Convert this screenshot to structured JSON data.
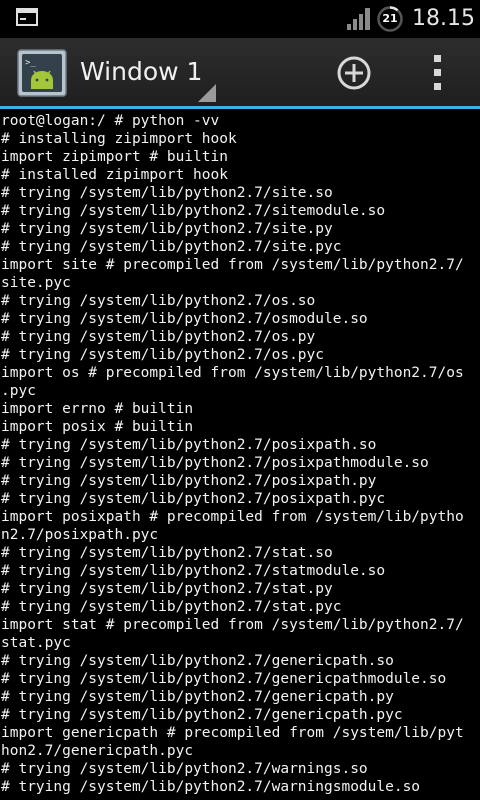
{
  "status_bar": {
    "icons": [
      "terminal-notification-icon",
      "signal-icon",
      "battery-icon"
    ],
    "battery_level": "21",
    "time": "18.15"
  },
  "action_bar": {
    "app_icon": "android-terminal-icon",
    "window_title": "Window 1",
    "add_icon": "add-circle-icon",
    "overflow_icon": "overflow-menu-icon",
    "accent_color": "#33b5e5"
  },
  "terminal": {
    "lines": [
      "root@logan:/ # python -vv",
      "# installing zipimport hook",
      "import zipimport # builtin",
      "# installed zipimport hook",
      "# trying /system/lib/python2.7/site.so",
      "# trying /system/lib/python2.7/sitemodule.so",
      "# trying /system/lib/python2.7/site.py",
      "# trying /system/lib/python2.7/site.pyc",
      "import site # precompiled from /system/lib/python2.7/",
      "site.pyc",
      "# trying /system/lib/python2.7/os.so",
      "# trying /system/lib/python2.7/osmodule.so",
      "# trying /system/lib/python2.7/os.py",
      "# trying /system/lib/python2.7/os.pyc",
      "import os # precompiled from /system/lib/python2.7/os",
      ".pyc",
      "import errno # builtin",
      "import posix # builtin",
      "# trying /system/lib/python2.7/posixpath.so",
      "# trying /system/lib/python2.7/posixpathmodule.so",
      "# trying /system/lib/python2.7/posixpath.py",
      "# trying /system/lib/python2.7/posixpath.pyc",
      "import posixpath # precompiled from /system/lib/pytho",
      "n2.7/posixpath.pyc",
      "# trying /system/lib/python2.7/stat.so",
      "# trying /system/lib/python2.7/statmodule.so",
      "# trying /system/lib/python2.7/stat.py",
      "# trying /system/lib/python2.7/stat.pyc",
      "import stat # precompiled from /system/lib/python2.7/",
      "stat.pyc",
      "# trying /system/lib/python2.7/genericpath.so",
      "# trying /system/lib/python2.7/genericpathmodule.so",
      "# trying /system/lib/python2.7/genericpath.py",
      "# trying /system/lib/python2.7/genericpath.pyc",
      "import genericpath # precompiled from /system/lib/pyt",
      "hon2.7/genericpath.pyc",
      "# trying /system/lib/python2.7/warnings.so",
      "# trying /system/lib/python2.7/warningsmodule.so"
    ]
  }
}
